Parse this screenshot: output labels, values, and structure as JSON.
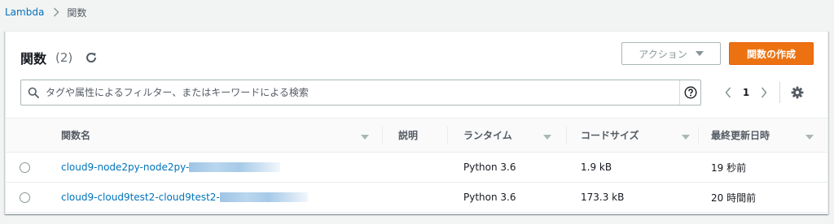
{
  "breadcrumb": {
    "parent": "Lambda",
    "current": "関数"
  },
  "header": {
    "title": "関数",
    "count": "(2)"
  },
  "actions": {
    "action_label": "アクション",
    "create_label": "関数の作成"
  },
  "search": {
    "placeholder": "タグや属性によるフィルター、またはキーワードによる検索",
    "value": ""
  },
  "pagination": {
    "current_page": "1"
  },
  "table": {
    "columns": [
      "関数名",
      "説明",
      "ランタイム",
      "コードサイズ",
      "最終更新日時"
    ],
    "rows": [
      {
        "name": "cloud9-node2py-node2py-",
        "description": "",
        "runtime": "Python 3.6",
        "code_size": "1.9 kB",
        "last_modified": "19 秒前"
      },
      {
        "name": "cloud9-cloud9test2-cloud9test2-",
        "description": "",
        "runtime": "Python 3.6",
        "code_size": "173.3 kB",
        "last_modified": "20 時間前"
      }
    ]
  },
  "colors": {
    "link": "#0073bb",
    "primary_button": "#ec7211",
    "background": "#f2f3f3"
  }
}
